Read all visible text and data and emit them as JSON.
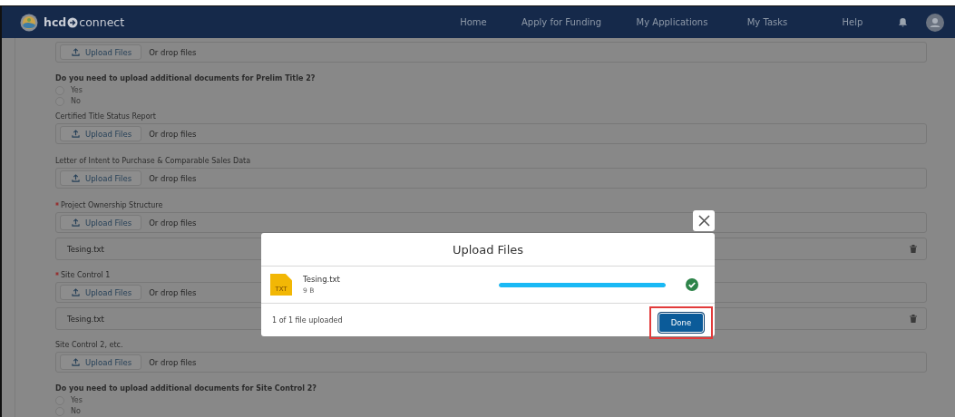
{
  "header": {
    "logo_bold": "hcd",
    "logo_light": "connect",
    "nav": [
      "Home",
      "Apply for Funding",
      "My Applications",
      "My Tasks",
      "Help"
    ]
  },
  "form": [
    {
      "kind": "upload",
      "button": "Upload Files",
      "drop": "Or drop files"
    },
    {
      "kind": "question",
      "text": "Do you need to upload additional documents for Prelim Title 2?",
      "options": [
        {
          "label": "Yes",
          "selected": false
        },
        {
          "label": "No",
          "selected": false
        }
      ]
    },
    {
      "kind": "upload",
      "label": "Certified Title Status Report",
      "required": false,
      "button": "Upload Files",
      "drop": "Or drop files"
    },
    {
      "kind": "upload",
      "label": "Letter of Intent to Purchase & Comparable Sales Data",
      "required": false,
      "button": "Upload Files",
      "drop": "Or drop files"
    },
    {
      "kind": "upload",
      "label": "Project Ownership Structure",
      "required": true,
      "button": "Upload Files",
      "drop": "Or drop files"
    },
    {
      "kind": "file",
      "name": "Tesing.txt"
    },
    {
      "kind": "upload",
      "label": "Site Control 1",
      "required": true,
      "button": "Upload Files",
      "drop": "Or drop files"
    },
    {
      "kind": "file",
      "name": "Tesing.txt"
    },
    {
      "kind": "upload",
      "label": "Site Control 2, etc.",
      "required": false,
      "button": "Upload Files",
      "drop": "Or drop files"
    },
    {
      "kind": "question",
      "text": "Do you need to upload additional documents for Site Control 2?",
      "options": [
        {
          "label": "Yes",
          "selected": false
        },
        {
          "label": "No",
          "selected": false
        }
      ]
    }
  ],
  "modal": {
    "title": "Upload Files",
    "file": {
      "badge": "TXT",
      "name": "Tesing.txt",
      "size": "9 B",
      "level": 1,
      "complete": true
    },
    "status": "1 of 1 file uploaded",
    "done": "Done",
    "done_highlighted": true
  }
}
